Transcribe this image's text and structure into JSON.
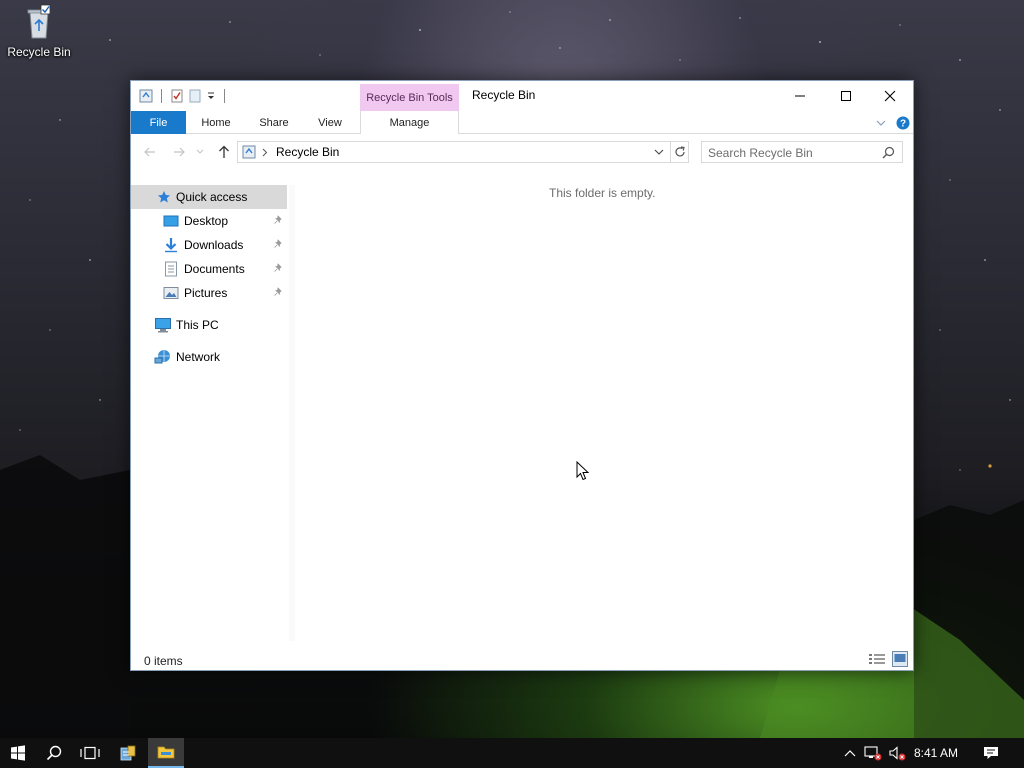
{
  "desktop": {
    "recycle_bin_label": "Recycle Bin"
  },
  "window": {
    "title": "Recycle Bin",
    "context_tab_group": "Recycle Bin Tools",
    "ribbon_tabs": {
      "file": "File",
      "home": "Home",
      "share": "Share",
      "view": "View",
      "manage": "Manage"
    },
    "address": {
      "path": "Recycle Bin"
    },
    "search": {
      "placeholder": "Search Recycle Bin"
    },
    "nav": {
      "quick_access": "Quick access",
      "desktop": "Desktop",
      "downloads": "Downloads",
      "documents": "Documents",
      "pictures": "Pictures",
      "this_pc": "This PC",
      "network": "Network"
    },
    "empty_message": "This folder is empty.",
    "status": {
      "item_count": "0 items"
    }
  },
  "taskbar": {
    "clock": "8:41 AM"
  },
  "icons": {
    "start": "windows-start-icon",
    "search": "search-icon",
    "task_view": "task-view-icon",
    "file_explorer": "file-explorer-icon",
    "network_tray": "network-tray-icon",
    "volume_tray": "volume-muted-icon",
    "action_center": "action-center-icon"
  },
  "colors": {
    "file_tab": "#1979ca",
    "context_tab": "#f1c9f0",
    "selected_nav": "#d9d9d9",
    "help": "#1979ca"
  }
}
